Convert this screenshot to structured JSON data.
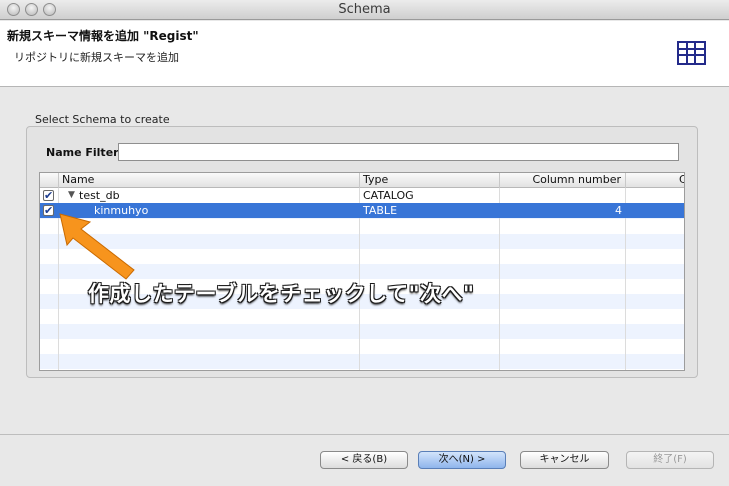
{
  "window": {
    "title": "Schema"
  },
  "header": {
    "title": "新規スキーマ情報を追加 \"Regist\"",
    "subtitle": "リポジトリに新規スキーマを追加",
    "icon": "table-icon"
  },
  "group": {
    "label": "Select Schema to create"
  },
  "filter": {
    "label": "Name Filter:",
    "value": ""
  },
  "table": {
    "columns": [
      "Name",
      "Type",
      "Column number",
      "C"
    ],
    "rows": [
      {
        "checked": true,
        "expanded": true,
        "name": "test_db",
        "type": "CATALOG",
        "column_number": "",
        "selected": false
      },
      {
        "checked": true,
        "expanded": false,
        "name": "kinmuhyo",
        "type": "TABLE",
        "column_number": "4",
        "selected": true
      }
    ],
    "check_mark": "✔",
    "expand_glyph": "▼"
  },
  "annotation": {
    "text": "作成したテーブルをチェックして\"次へ\"",
    "color": "#f7941d"
  },
  "buttons": {
    "back": "< 戻る(B)",
    "next": "次へ(N) >",
    "cancel": "キャンセル",
    "finish": "終了(F)"
  },
  "colors": {
    "selection": "#3875d7",
    "accent_icon": "#232a8a"
  }
}
